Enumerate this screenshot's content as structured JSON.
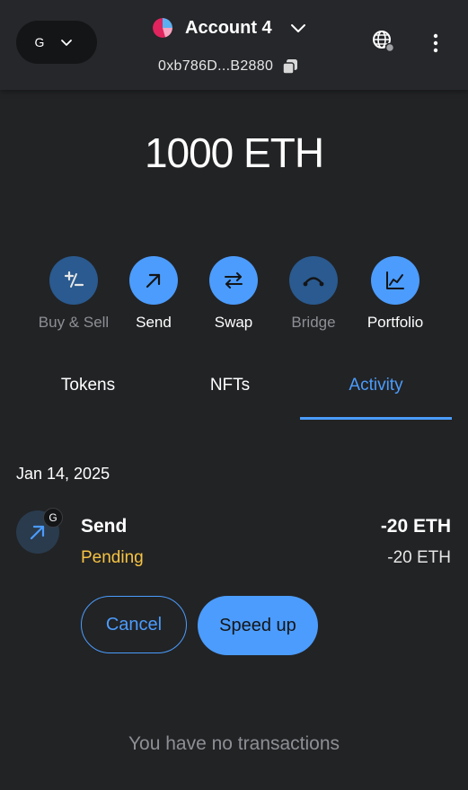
{
  "header": {
    "network": {
      "letter": "G",
      "icon": "chevron-down-icon"
    },
    "account": {
      "name": "Account 4",
      "avatar": "account-avatar",
      "chevron": "chevron-down-icon"
    },
    "address": "0xb786D...B2880",
    "copy_icon": "copy-icon",
    "globe_icon": "globe-connection-icon",
    "menu_icon": "kebab-menu-icon"
  },
  "balance": "1000 ETH",
  "actions": [
    {
      "label": "Buy & Sell",
      "icon": "plus-minus-icon",
      "state": "disabled"
    },
    {
      "label": "Send",
      "icon": "arrow-up-right-icon",
      "state": "enabled"
    },
    {
      "label": "Swap",
      "icon": "swap-arrows-icon",
      "state": "enabled"
    },
    {
      "label": "Bridge",
      "icon": "bridge-icon",
      "state": "disabled"
    },
    {
      "label": "Portfolio",
      "icon": "chart-icon",
      "state": "enabled"
    }
  ],
  "tabs": [
    {
      "label": "Tokens",
      "selected": false
    },
    {
      "label": "NFTs",
      "selected": false
    },
    {
      "label": "Activity",
      "selected": true
    }
  ],
  "activity": {
    "date": "Jan 14, 2025",
    "transaction": {
      "title": "Send",
      "status": "Pending",
      "badge": "G",
      "amount_primary": "-20 ETH",
      "amount_secondary": "-20 ETH"
    },
    "cancel_label": "Cancel",
    "speed_up_label": "Speed up",
    "empty_text": "You have no transactions"
  },
  "colors": {
    "accent": "#4b9cfd",
    "pending": "#f6c343",
    "background": "#222325",
    "header": "#25272a"
  }
}
